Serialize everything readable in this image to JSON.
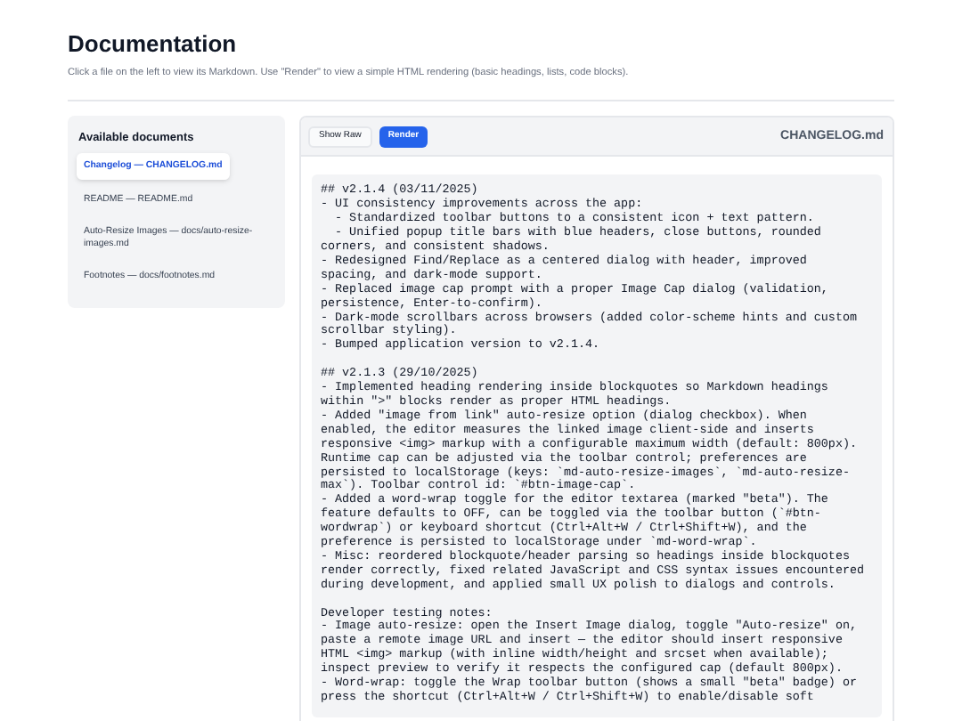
{
  "header": {
    "title": "Documentation",
    "subtitle": "Click a file on the left to view its Markdown. Use \"Render\" to view a simple HTML rendering (basic headings, lists, code blocks)."
  },
  "sidebar": {
    "title": "Available documents",
    "items": [
      {
        "label": "Changelog — CHANGELOG.md",
        "selected": true
      },
      {
        "label": "README — README.md",
        "selected": false
      },
      {
        "label": "Auto-Resize Images — docs/auto-resize-images.md",
        "selected": false
      },
      {
        "label": "Footnotes — docs/footnotes.md",
        "selected": false
      }
    ]
  },
  "viewer": {
    "modes": [
      {
        "label": "Show Raw",
        "selected": false
      },
      {
        "label": "Render",
        "selected": true
      }
    ],
    "filename": "CHANGELOG.md",
    "content": "## v2.1.4 (03/11/2025)\n- UI consistency improvements across the app:\n  - Standardized toolbar buttons to a consistent icon + text pattern.\n  - Unified popup title bars with blue headers, close buttons, rounded\ncorners, and consistent shadows.\n- Redesigned Find/Replace as a centered dialog with header, improved\nspacing, and dark-mode support.\n- Replaced image cap prompt with a proper Image Cap dialog (validation,\npersistence, Enter-to-confirm).\n- Dark-mode scrollbars across browsers (added color-scheme hints and custom\nscrollbar styling).\n- Bumped application version to v2.1.4.\n\n## v2.1.3 (29/10/2025)\n- Implemented heading rendering inside blockquotes so Markdown headings\nwithin \">\" blocks render as proper HTML headings.\n- Added \"image from link\" auto-resize option (dialog checkbox). When\nenabled, the editor measures the linked image client-side and inserts\nresponsive <img> markup with a configurable maximum width (default: 800px).\nRuntime cap can be adjusted via the toolbar control; preferences are\npersisted to localStorage (keys: `md-auto-resize-images`, `md-auto-resize-\nmax`). Toolbar control id: `#btn-image-cap`.\n- Added a word-wrap toggle for the editor textarea (marked \"beta\"). The\nfeature defaults to OFF, can be toggled via the toolbar button (`#btn-\nwordwrap`) or keyboard shortcut (Ctrl+Alt+W / Ctrl+Shift+W), and the\npreference is persisted to localStorage under `md-word-wrap`.\n- Misc: reordered blockquote/header parsing so headings inside blockquotes\nrender correctly, fixed related JavaScript and CSS syntax issues encountered\nduring development, and applied small UX polish to dialogs and controls.\n\nDeveloper testing notes:\n- Image auto-resize: open the Insert Image dialog, toggle \"Auto-resize\" on,\npaste a remote image URL and insert — the editor should insert responsive\nHTML <img> markup (with inline width/height and srcset when available);\ninspect preview to verify it respects the configured cap (default 800px).\n- Word-wrap: toggle the Wrap toolbar button (shows a small \"beta\" badge) or\npress the shortcut (Ctrl+Alt+W / Ctrl+Shift+W) to enable/disable soft"
  }
}
